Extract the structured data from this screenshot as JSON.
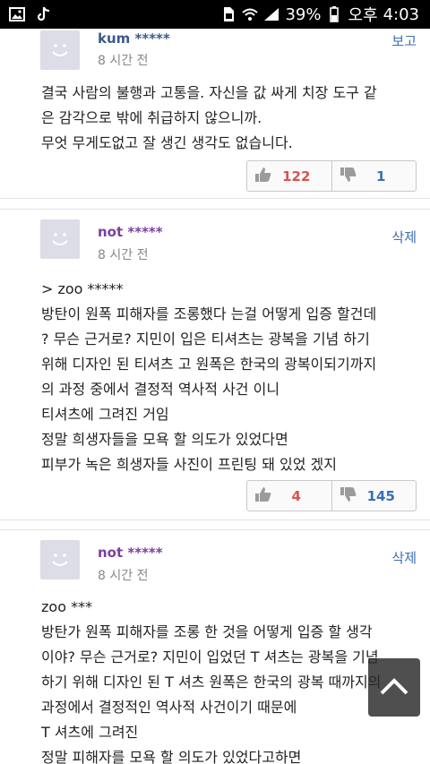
{
  "status_bar": {
    "battery": "39%",
    "ampm": "오후",
    "time": "4:03"
  },
  "comments": [
    {
      "username": "kum *****",
      "time": "8 시간 전",
      "action": "보고",
      "lines": [
        "결국 사람의 불행과 고통을. 자신을 값 싸게 치장 도구 같",
        "은 감각으로 밖에 취급하지 않으니까.",
        "무엇 무게도없고 잘 생긴 생각도 없습니다."
      ],
      "likes": "122",
      "dislikes": "1"
    },
    {
      "username": "not *****",
      "time": "8 시간 전",
      "action": "삭제",
      "lines": [
        "> zoo *****",
        "방탄이 원폭 피해자를 조롱했다 는걸 어떻게 입증 할건데",
        "? 무슨 근거로? 지민이 입은 티셔츠는 광복을 기념 하기",
        "위해 디자인 된 티셔츠 고 원폭은 한국의 광복이되기까지",
        "의 과정 중에서 결정적 역사적 사건 이니",
        "티셔츠에 그려진 거임",
        "정말 희생자들을 모욕 할 의도가 있었다면",
        "피부가 녹은 희생자들 사진이 프린팅 돼 있었 겠지"
      ],
      "likes": "4",
      "dislikes": "145"
    },
    {
      "username": "not *****",
      "time": "8 시간 전",
      "action": "삭제",
      "lines": [
        "zoo ***",
        "방탄가 원폭 피해자를 조롱 한 것을 어떻게 입증 할 생각",
        "이야? 무슨 근거로? 지민이 입었던 T 셔츠는 광복을 기념",
        "하기 위해 디자인 된 T 셔츠 원폭은 한국의 광복 때까지의",
        "과정에서 결정적인 역사적 사건이기 때문에",
        "T 셔츠에 그려진",
        "정말 피해자를 모욕 할 의도가 있었다고하면"
      ]
    }
  ],
  "icons": {
    "gallery": "image-icon",
    "tiktok": "tiktok-icon",
    "like": "thumbs-up-icon",
    "dislike": "thumbs-down-icon",
    "scroll": "chevron-up-icon"
  },
  "colors": {
    "like": "#d9534f",
    "dislike": "#3a6fb4",
    "username_kum": "#3b5a8a",
    "username_not": "#7a3fa0",
    "action": "#3c6fb0"
  }
}
